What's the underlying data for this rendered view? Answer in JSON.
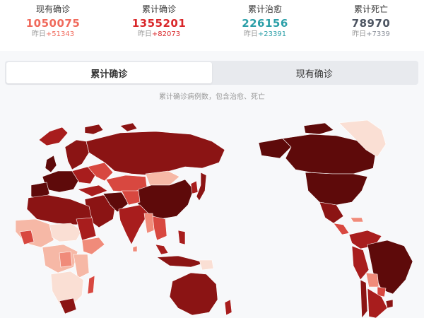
{
  "stats": [
    {
      "label": "现有确诊",
      "value": "1050075",
      "delta_prefix": "昨日",
      "delta": "+51343",
      "color": "#f06a5c",
      "delta_color": "#f06a5c"
    },
    {
      "label": "累计确诊",
      "value": "1355201",
      "delta_prefix": "昨日",
      "delta": "+82073",
      "color": "#d9272a",
      "delta_color": "#d9272a"
    },
    {
      "label": "累计治愈",
      "value": "226156",
      "delta_prefix": "昨日",
      "delta": "+23391",
      "color": "#2b9fa8",
      "delta_color": "#2b9fa8"
    },
    {
      "label": "累计死亡",
      "value": "78970",
      "delta_prefix": "昨日",
      "delta": "+7339",
      "color": "#4d5562",
      "delta_color": "#8a8f99"
    }
  ],
  "tabs": [
    {
      "label": "累计确诊",
      "active": true
    },
    {
      "label": "现有确诊",
      "active": false
    }
  ],
  "caption": "累计确诊病例数，包含治愈、死亡",
  "map": {
    "colors": {
      "darkest": "#5e0a0a",
      "dark": "#8b1414",
      "medium_dark": "#a81d1d",
      "medium": "#d84840",
      "light": "#f08b7a",
      "lighter": "#f6b8a6",
      "lightest": "#fadfd4",
      "background": "#f7f8fa"
    }
  }
}
